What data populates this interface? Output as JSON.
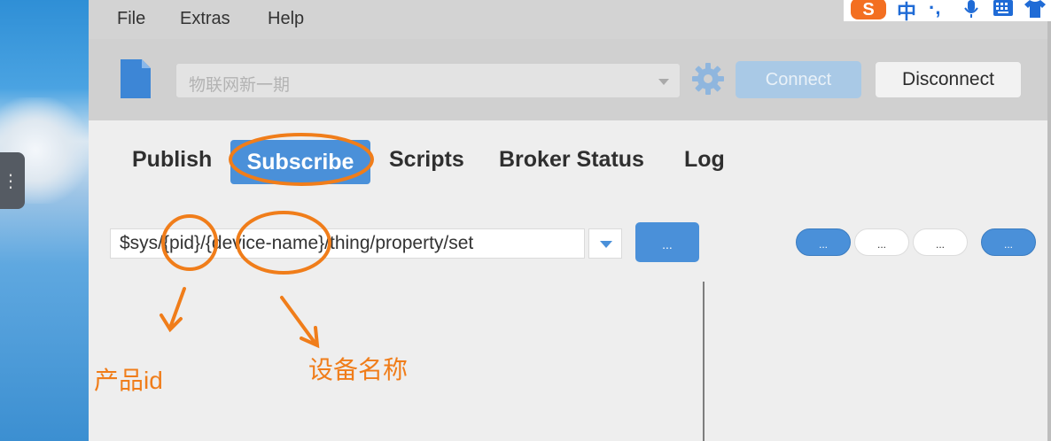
{
  "menu": {
    "file": "File",
    "extras": "Extras",
    "help": "Help"
  },
  "toolbar": {
    "profile_value": "物联网新一期",
    "connect_label": "Connect",
    "disconnect_label": "Disconnect"
  },
  "tabs": {
    "publish": "Publish",
    "subscribe": "Subscribe",
    "scripts": "Scripts",
    "broker_status": "Broker Status",
    "log": "Log",
    "active": "Subscribe"
  },
  "subscribe": {
    "topic_value": "$sys/{pid}/{device-name}/thing/property/set",
    "subscribe_button_label": "...",
    "option_buttons": [
      "...",
      "...",
      "...",
      "..."
    ]
  },
  "annotations": {
    "pid_label": "产品id",
    "device_label": "设备名称"
  },
  "ime": {
    "mode_char": "中",
    "punct": "·,",
    "logo_letter": "S"
  },
  "colors": {
    "accent": "#4a90d9",
    "annotation": "#f07d1a",
    "connect_disabled": "#a9c9e6"
  }
}
